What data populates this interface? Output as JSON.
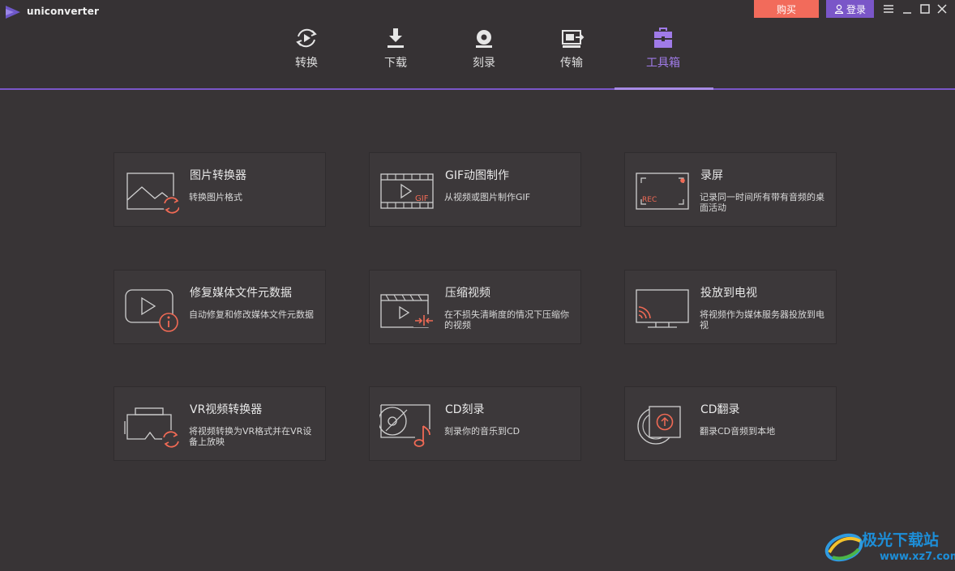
{
  "app": {
    "title": "uniconverter"
  },
  "titlebar": {
    "buy_label": "购买",
    "login_label": "登录"
  },
  "nav": {
    "tabs": [
      {
        "label": "转换",
        "icon": "convert-play-icon",
        "active": false
      },
      {
        "label": "下载",
        "icon": "download-arrow-icon",
        "active": false
      },
      {
        "label": "刻录",
        "icon": "disc-burn-icon",
        "active": false
      },
      {
        "label": "传输",
        "icon": "transfer-device-icon",
        "active": false
      },
      {
        "label": "工具箱",
        "icon": "toolbox-icon",
        "active": true
      }
    ]
  },
  "tools": [
    {
      "title": "图片转换器",
      "desc": "转换图片格式",
      "icon": "image-convert-icon"
    },
    {
      "title": "GIF动图制作",
      "desc": "从视频或图片制作GIF",
      "icon": "gif-maker-icon"
    },
    {
      "title": "录屏",
      "desc": "记录同一时间所有带有音频的桌面活动",
      "icon": "screen-record-icon"
    },
    {
      "title": "修复媒体文件元数据",
      "desc": "自动修复和修改媒体文件元数据",
      "icon": "metadata-fix-icon"
    },
    {
      "title": "压缩视频",
      "desc": "在不损失清晰度的情况下压缩你的视频",
      "icon": "compress-video-icon"
    },
    {
      "title": "投放到电视",
      "desc": "将视频作为媒体服务器投放到电视",
      "icon": "cast-tv-icon"
    },
    {
      "title": "VR视频转换器",
      "desc": "将视频转换为VR格式并在VR设备上放映",
      "icon": "vr-convert-icon"
    },
    {
      "title": "CD刻录",
      "desc": "刻录你的音乐到CD",
      "icon": "cd-burn-icon"
    },
    {
      "title": "CD翻录",
      "desc": "翻录CD音频到本地",
      "icon": "cd-rip-icon"
    }
  ],
  "watermark": {
    "brand": "极光下载站",
    "url": "www.xz7.com"
  },
  "colors": {
    "accent": "#7a56c8",
    "buy": "#f26b5b",
    "icon_accent": "#f06a55",
    "background": "#383436"
  }
}
